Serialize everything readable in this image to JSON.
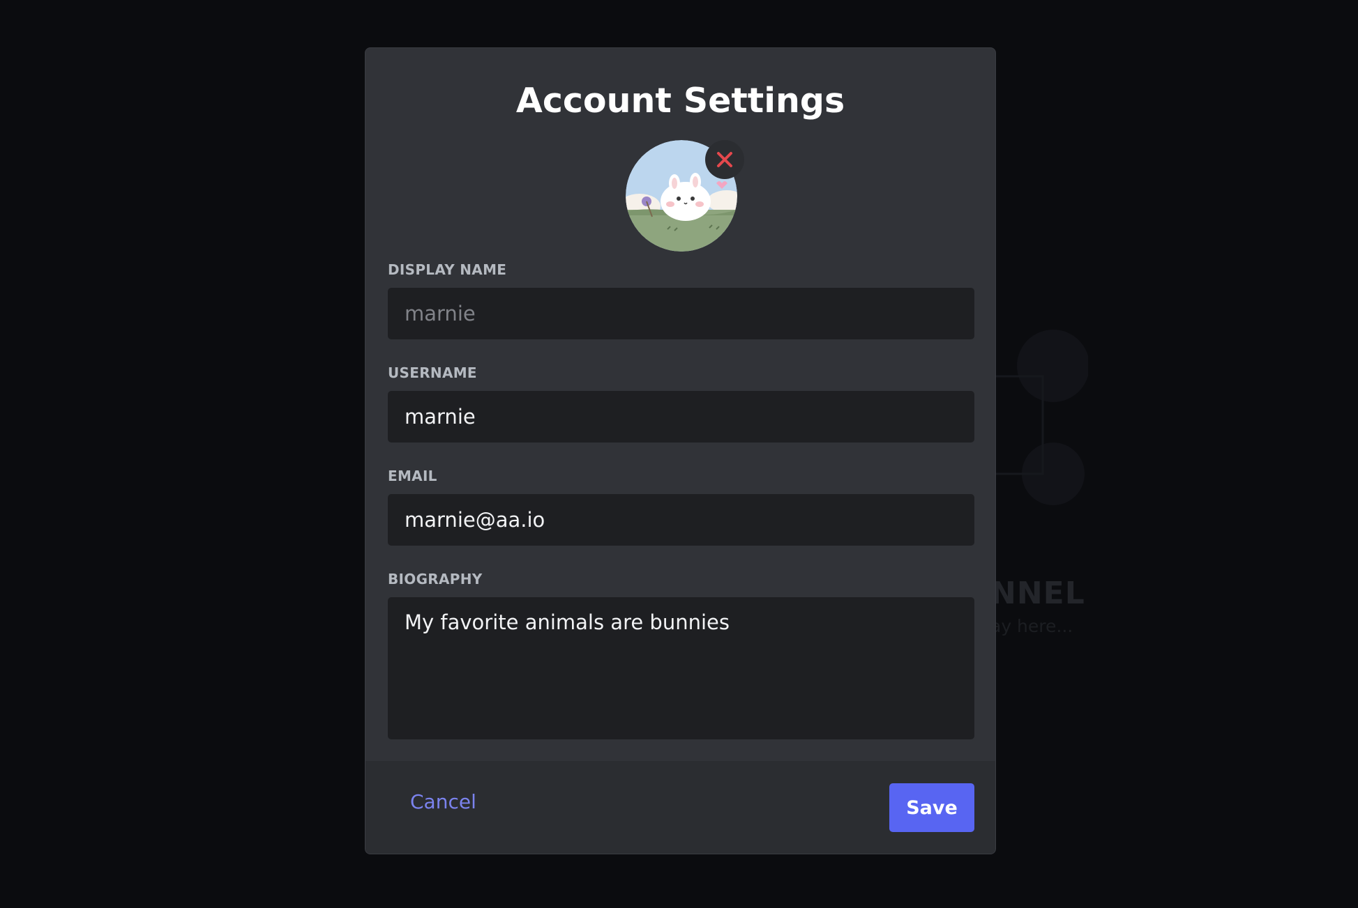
{
  "modal": {
    "title": "Account Settings"
  },
  "avatar": {
    "image": "bunny-avatar",
    "remove_icon": "close-icon",
    "remove_color": "#e5484d"
  },
  "fields": {
    "display_name": {
      "label": "DISPLAY NAME",
      "value": "",
      "placeholder": "marnie"
    },
    "username": {
      "label": "USERNAME",
      "value": "marnie"
    },
    "email": {
      "label": "EMAIL",
      "value": "marnie@aa.io"
    },
    "biography": {
      "label": "BIOGRAPHY",
      "value": "My favorite animals are bunnies"
    }
  },
  "footer": {
    "cancel_label": "Cancel",
    "save_label": "Save"
  },
  "background": {
    "heading": "NNEL",
    "subtext": "ay here..."
  },
  "colors": {
    "accent": "#5865f2",
    "link": "#7b83ee",
    "modal_bg": "#313338",
    "input_bg": "#1e1f22"
  }
}
